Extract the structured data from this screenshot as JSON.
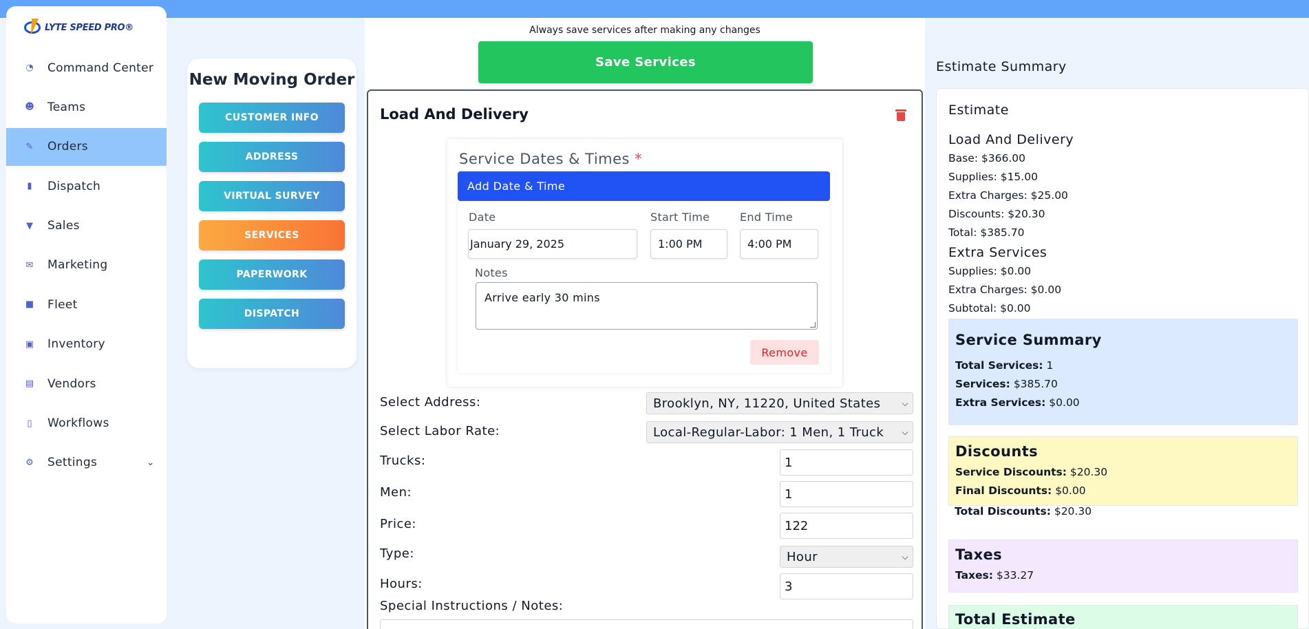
{
  "brand": {
    "logo_text": "LYTE SPEED PRO®"
  },
  "sidebar": {
    "items": [
      {
        "label": "Command Center",
        "icon": "gauge-icon"
      },
      {
        "label": "Teams",
        "icon": "users-icon"
      },
      {
        "label": "Orders",
        "icon": "edit-icon",
        "active": true
      },
      {
        "label": "Dispatch",
        "icon": "walkie-talkie-icon"
      },
      {
        "label": "Sales",
        "icon": "funnel-icon"
      },
      {
        "label": "Marketing",
        "icon": "mail-bulk-icon"
      },
      {
        "label": "Fleet",
        "icon": "truck-icon"
      },
      {
        "label": "Inventory",
        "icon": "boxes-icon"
      },
      {
        "label": "Vendors",
        "icon": "archive-icon"
      },
      {
        "label": "Workflows",
        "icon": "clipboard-icon"
      },
      {
        "label": "Settings",
        "icon": "gear-icon",
        "has_chevron": true
      }
    ]
  },
  "steps": {
    "title": "New Moving Order",
    "items": [
      {
        "label": "CUSTOMER INFO",
        "active": false
      },
      {
        "label": "ADDRESS",
        "active": false
      },
      {
        "label": "VIRTUAL SURVEY",
        "active": false
      },
      {
        "label": "SERVICES",
        "active": true
      },
      {
        "label": "PAPERWORK",
        "active": false
      },
      {
        "label": "DISPATCH",
        "active": false
      }
    ]
  },
  "main": {
    "save_hint": "Always save services after making any changes",
    "save_button": "Save Services",
    "service": {
      "title": "Load And Delivery",
      "dates": {
        "title": "Service Dates & Times",
        "required_mark": "*",
        "add_button": "Add Date & Time",
        "date_label": "Date",
        "date_value": "January 29, 2025",
        "start_label": "Start Time",
        "start_value": "1:00 PM",
        "end_label": "End Time",
        "end_value": "4:00 PM",
        "notes_label": "Notes",
        "notes_value": "Arrive early 30 mins",
        "remove_button": "Remove"
      },
      "address_label": "Select Address:",
      "address_value": "Brooklyn, NY, 11220, United States",
      "labor_label": "Select Labor Rate:",
      "labor_value": "Local-Regular-Labor: 1 Men, 1 Truck",
      "trucks_label": "Trucks:",
      "trucks_value": "1",
      "men_label": "Men:",
      "men_value": "1",
      "price_label": "Price:",
      "price_value": "122",
      "type_label": "Type:",
      "type_value": "Hour",
      "hours_label": "Hours:",
      "hours_value": "3",
      "notes_label": "Special Instructions / Notes:"
    }
  },
  "summary": {
    "heading": "Estimate Summary",
    "estimate_title": "Estimate",
    "load": {
      "title": "Load And Delivery",
      "base": "Base: $366.00",
      "supplies": "Supplies: $15.00",
      "extra_charges": "Extra Charges: $25.00",
      "discounts": "Discounts: $20.30",
      "total": "Total: $385.70"
    },
    "extra": {
      "title": "Extra Services",
      "supplies": "Supplies: $0.00",
      "extra_charges": "Extra Charges: $0.00",
      "subtotal": "Subtotal: $0.00"
    },
    "service_summary": {
      "title": "Service Summary",
      "total_services_label": "Total Services:",
      "total_services_value": "1",
      "services_label": "Services:",
      "services_value": "$385.70",
      "extra_services_label": "Extra Services:",
      "extra_services_value": "$0.00"
    },
    "discounts": {
      "title": "Discounts",
      "service_label": "Service Discounts:",
      "service_value": "$20.30",
      "final_label": "Final Discounts:",
      "final_value": "$0.00",
      "total_label": "Total Discounts:",
      "total_value": "$20.30"
    },
    "taxes": {
      "title": "Taxes",
      "label": "Taxes:",
      "value": "$33.27"
    },
    "total_estimate": {
      "title": "Total Estimate"
    }
  },
  "colors": {
    "topbar": "#60a5fa",
    "active_nav": "#93c5fd",
    "save_button": "#22c55e",
    "add_date_button": "#2152f3",
    "step_active": "#f97334",
    "step_default": "#2ec4cf",
    "delete": "#ef4444"
  }
}
